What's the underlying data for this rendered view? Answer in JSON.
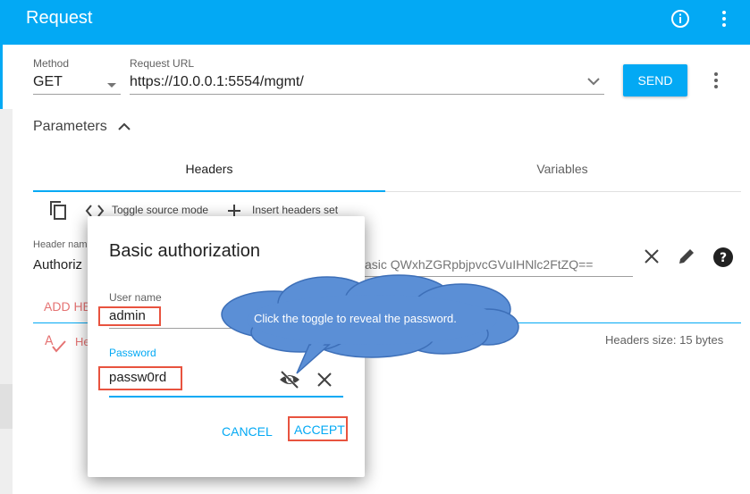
{
  "app": {
    "title": "Request"
  },
  "request": {
    "method_label": "Method",
    "method_value": "GET",
    "url_label": "Request URL",
    "url_value": "https://10.0.0.1:5554/mgmt/",
    "send_label": "SEND"
  },
  "parameters": {
    "label": "Parameters"
  },
  "tabs": [
    {
      "label": "Headers",
      "active": true
    },
    {
      "label": "Variables",
      "active": false
    }
  ],
  "toolbar": {
    "toggle_label": "Toggle source mode",
    "insert_label": "Insert headers set"
  },
  "headers": {
    "name_label": "Header nam",
    "name_value": "Authoriz",
    "value_partial": "asic QWxhZGRpbjpvcGVuIHNlc2FtZQ==",
    "add_label": "ADD HE",
    "help_partial": "He",
    "size_text": "Headers size: 15 bytes"
  },
  "dialog": {
    "title": "Basic authorization",
    "username_label": "User name",
    "username_value": "admin",
    "password_label": "Password",
    "password_value": "passw0rd",
    "cancel_label": "CANCEL",
    "accept_label": "ACCEPT"
  },
  "callout": {
    "text": "Click the toggle to reveal  the password."
  },
  "colors": {
    "accent": "#03a9f4",
    "highlight": "#e8533f",
    "callout": "#5b8fd6",
    "error": "#e57373"
  }
}
